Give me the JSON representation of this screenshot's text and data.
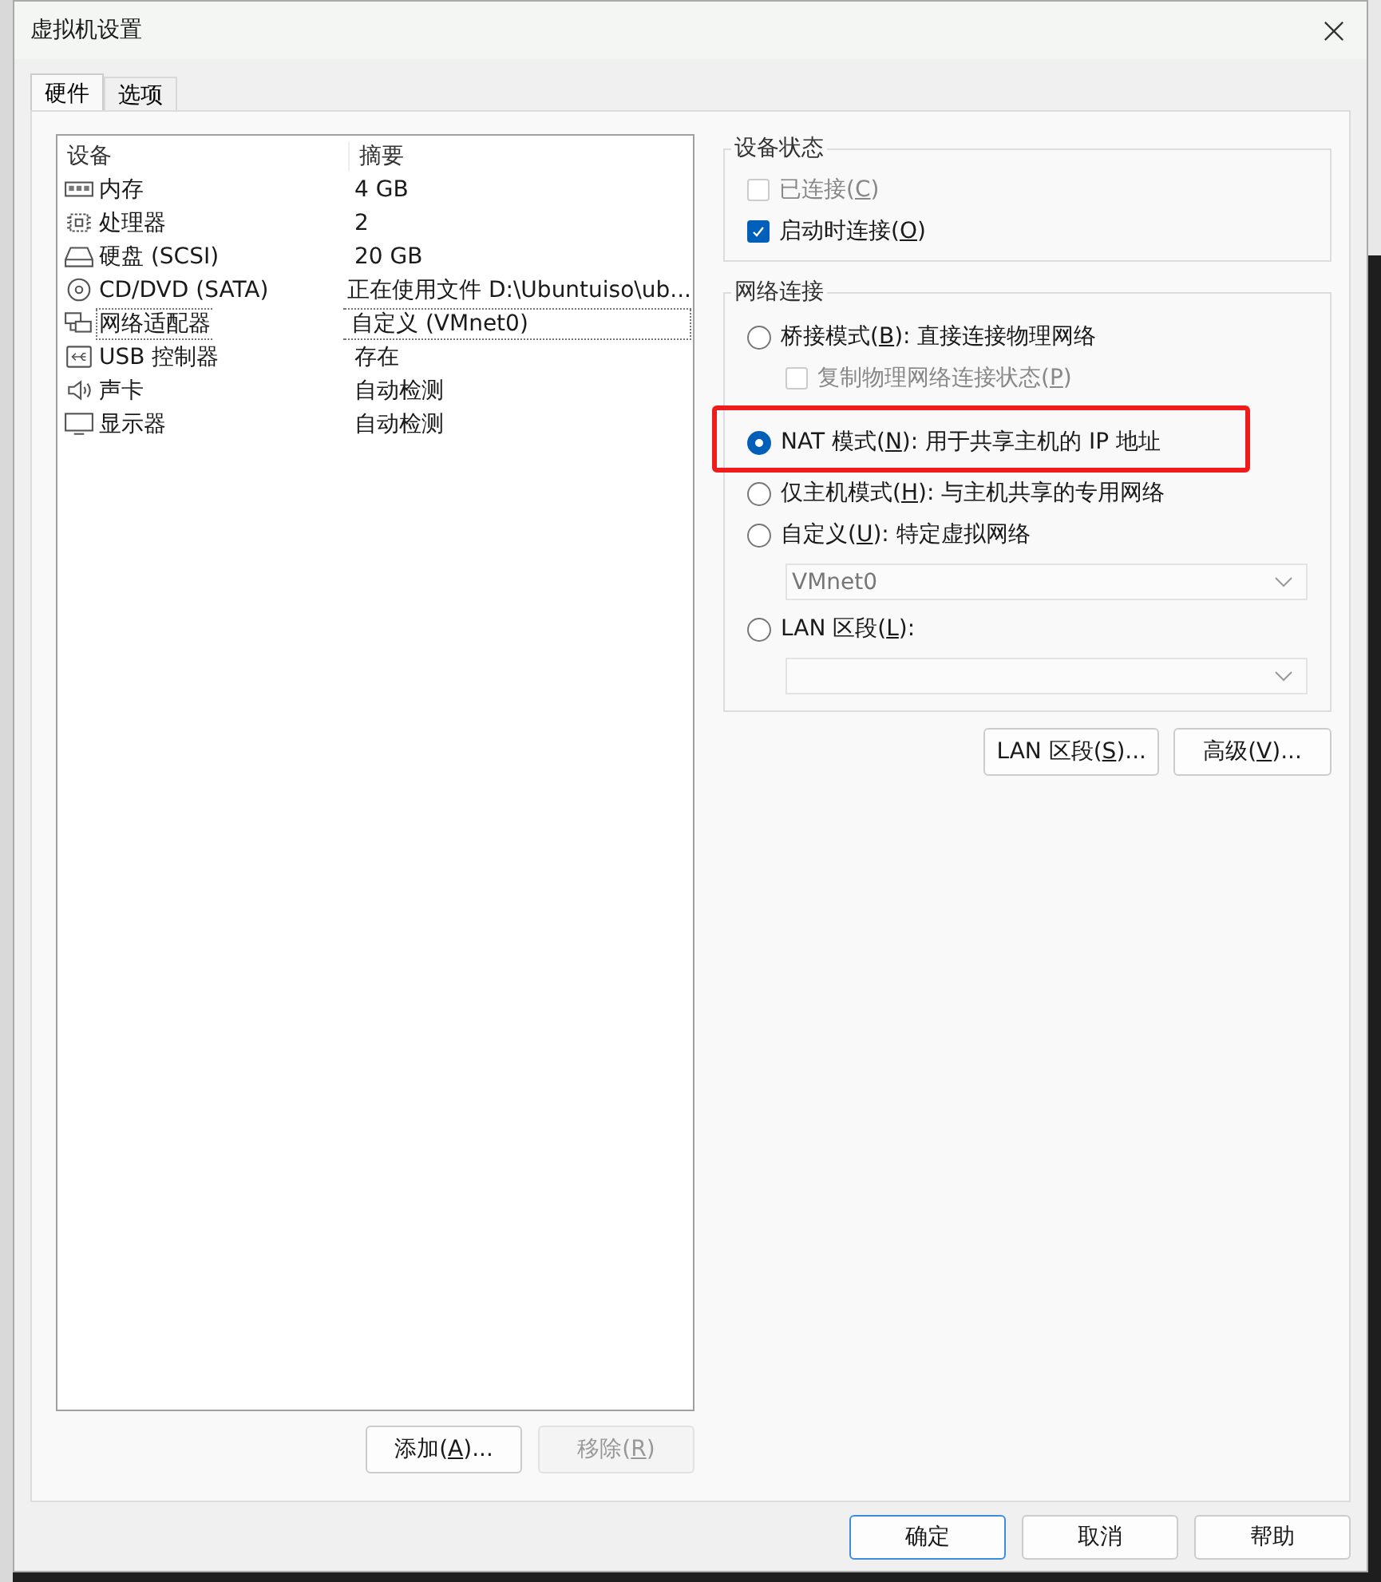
{
  "window": {
    "title": "虚拟机设置"
  },
  "tabs": [
    {
      "label": "硬件",
      "selected": true
    },
    {
      "label": "选项",
      "selected": false
    }
  ],
  "device_list": {
    "columns": [
      "设备",
      "摘要"
    ],
    "rows": [
      {
        "kind": "memory",
        "device": "内存",
        "summary": "4 GB",
        "selected": false
      },
      {
        "kind": "processor",
        "device": "处理器",
        "summary": "2",
        "selected": false
      },
      {
        "kind": "disk",
        "device": "硬盘 (SCSI)",
        "summary": "20 GB",
        "selected": false
      },
      {
        "kind": "cd",
        "device": "CD/DVD (SATA)",
        "summary": "正在使用文件 D:\\Ubuntuiso\\ub...",
        "selected": false
      },
      {
        "kind": "network",
        "device": "网络适配器",
        "summary": "自定义 (VMnet0)",
        "selected": true
      },
      {
        "kind": "usb",
        "device": "USB 控制器",
        "summary": "存在",
        "selected": false
      },
      {
        "kind": "sound",
        "device": "声卡",
        "summary": "自动检测",
        "selected": false
      },
      {
        "kind": "display",
        "device": "显示器",
        "summary": "自动检测",
        "selected": false
      }
    ]
  },
  "list_buttons": [
    {
      "label": {
        "before": "添加(",
        "key": "A",
        "after": ")..."
      },
      "disabled": false
    },
    {
      "label": {
        "before": "移除(",
        "key": "R",
        "after": ")"
      },
      "disabled": true
    }
  ],
  "device_status": {
    "title": "设备状态",
    "options": [
      {
        "label": {
          "before": "已连接(",
          "key": "C",
          "after": ")"
        },
        "checked": false,
        "disabled": true
      },
      {
        "label": {
          "before": "启动时连接(",
          "key": "O",
          "after": ")"
        },
        "checked": true,
        "disabled": false
      }
    ]
  },
  "network_connection": {
    "title": "网络连接",
    "items": [
      {
        "kind": "radio",
        "label": {
          "before": "桥接模式(",
          "key": "B",
          "after": "): 直接连接物理网络"
        },
        "selected": false
      },
      {
        "kind": "checkbox",
        "label": {
          "before": "复制物理网络连接状态(",
          "key": "P",
          "after": ")"
        },
        "checked": false,
        "disabled": true
      },
      {
        "kind": "radio",
        "label": {
          "before": "NAT 模式(",
          "key": "N",
          "after": "): 用于共享主机的 IP 地址"
        },
        "selected": true,
        "highlighted": true
      },
      {
        "kind": "radio",
        "label": {
          "before": "仅主机模式(",
          "key": "H",
          "after": "): 与主机共享的专用网络"
        },
        "selected": false
      },
      {
        "kind": "radio",
        "label": {
          "before": "自定义(",
          "key": "U",
          "after": "): 特定虚拟网络"
        },
        "selected": false
      },
      {
        "kind": "dropdown",
        "value": "VMnet0",
        "disabled": true
      },
      {
        "kind": "radio",
        "label": {
          "before": "LAN 区段(",
          "key": "L",
          "after": "):"
        },
        "selected": false
      },
      {
        "kind": "dropdown",
        "disabled": true
      }
    ]
  },
  "network_buttons": [
    {
      "label": {
        "before": "LAN 区段(",
        "key": "S",
        "after": ")..."
      },
      "disabled": false
    },
    {
      "label": {
        "before": "高级(",
        "key": "V",
        "after": ")..."
      },
      "disabled": false
    }
  ],
  "dialog_buttons": [
    {
      "label": "确定",
      "default": true
    },
    {
      "label": "取消",
      "default": false
    },
    {
      "label": "帮助",
      "default": false
    }
  ]
}
